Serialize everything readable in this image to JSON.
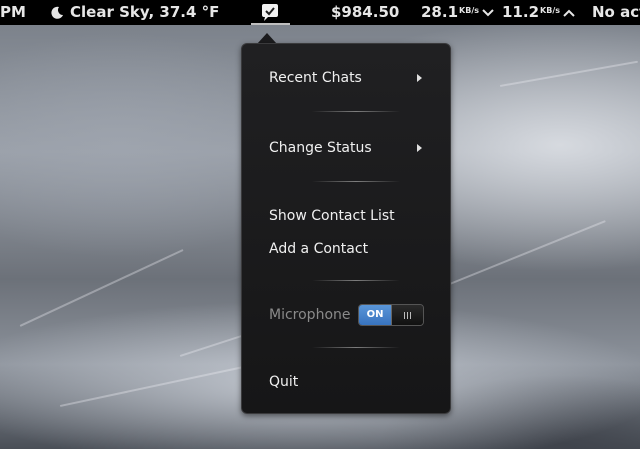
{
  "topbar": {
    "clock": "PM",
    "weather": "Clear Sky, 37.4 °F",
    "stocks": "$984.50",
    "net_down": "28.1",
    "net_down_unit": "KB/s",
    "net_up": "11.2",
    "net_up_unit": "KB/s",
    "activity": "No act"
  },
  "menu": {
    "recent_chats": "Recent Chats",
    "change_status": "Change Status",
    "show_contact_list": "Show Contact List",
    "add_contact": "Add a Contact",
    "microphone": "Microphone",
    "microphone_toggle": "ON",
    "quit": "Quit"
  },
  "colors": {
    "toggle_on": "#3f80cf",
    "topbar_bg": "#000000",
    "menu_bg": "#1b1b1c"
  }
}
